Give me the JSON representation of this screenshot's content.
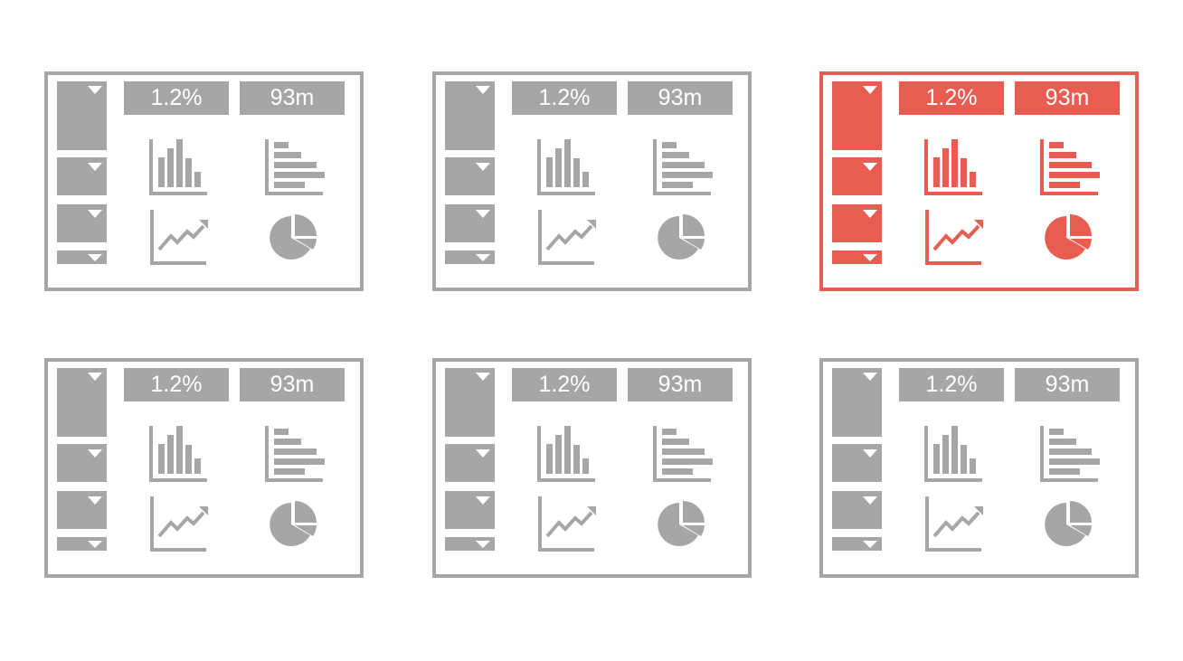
{
  "colors": {
    "neutral": "#a6a6a6",
    "accent": "#e85c52",
    "background": "#ffffff"
  },
  "cards": [
    {
      "state": "default",
      "kpi_1": "1.2%",
      "kpi_2": "93m"
    },
    {
      "state": "default",
      "kpi_1": "1.2%",
      "kpi_2": "93m"
    },
    {
      "state": "selected",
      "kpi_1": "1.2%",
      "kpi_2": "93m"
    },
    {
      "state": "default",
      "kpi_1": "1.2%",
      "kpi_2": "93m"
    },
    {
      "state": "default",
      "kpi_1": "1.2%",
      "kpi_2": "93m"
    },
    {
      "state": "default",
      "kpi_1": "1.2%",
      "kpi_2": "93m"
    }
  ],
  "icons": [
    "dropdown-icon",
    "bar-chart-icon",
    "horizontal-bar-chart-icon",
    "line-chart-icon",
    "pie-chart-icon"
  ]
}
